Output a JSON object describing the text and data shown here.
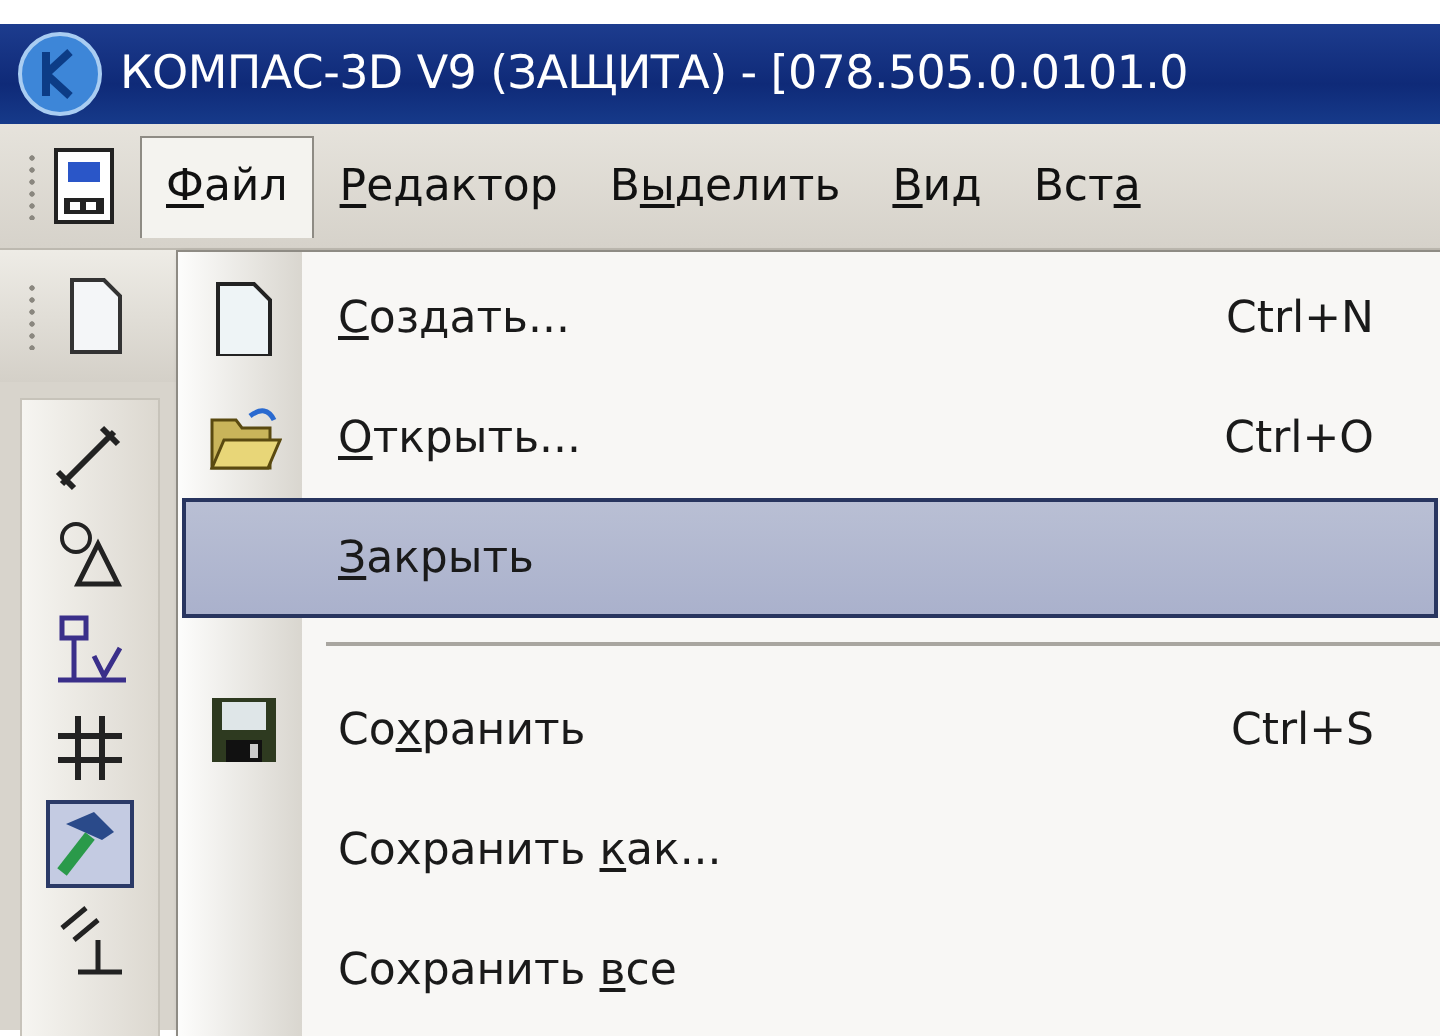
{
  "window": {
    "title": "КОМПАС-3D V9 (ЗАЩИТА) - [078.505.0.0101.0"
  },
  "menu_bar": [
    {
      "access_key": "Ф",
      "text_after": "айл",
      "selected": true
    },
    {
      "access_key": "Р",
      "text_after": "едактор",
      "selected": false
    },
    {
      "text_before": "В",
      "access_key": "ы",
      "text_after": "делить",
      "selected": false
    },
    {
      "access_key": "В",
      "text_after": "ид",
      "selected": false
    },
    {
      "text_before": "Вст",
      "access_key": "а",
      "selected": false
    }
  ],
  "file_menu": [
    {
      "kind": "command",
      "access_key": "С",
      "text_after": "оздать...",
      "shortcut": "Ctrl+N",
      "selected": false
    },
    {
      "kind": "command",
      "access_key": "О",
      "text_after": "ткрыть...",
      "shortcut": "Ctrl+O",
      "selected": false
    },
    {
      "kind": "command",
      "access_key": "З",
      "text_after": "акрыть",
      "selected": true
    },
    {
      "kind": "separator"
    },
    {
      "kind": "command",
      "text_before": "Со",
      "access_key": "х",
      "text_after": "ранить",
      "shortcut": "Ctrl+S",
      "selected": false
    },
    {
      "kind": "command",
      "text_before": "Сохранить ",
      "access_key": "к",
      "text_after": "ак...",
      "selected": false
    },
    {
      "kind": "command",
      "text_before": "Сохранить ",
      "access_key": "в",
      "text_after": "се",
      "selected": false
    }
  ],
  "tools": [
    {
      "selected": false
    },
    {
      "selected": false
    },
    {
      "selected": false
    },
    {
      "selected": false
    },
    {
      "selected": true
    },
    {
      "selected": false
    }
  ]
}
